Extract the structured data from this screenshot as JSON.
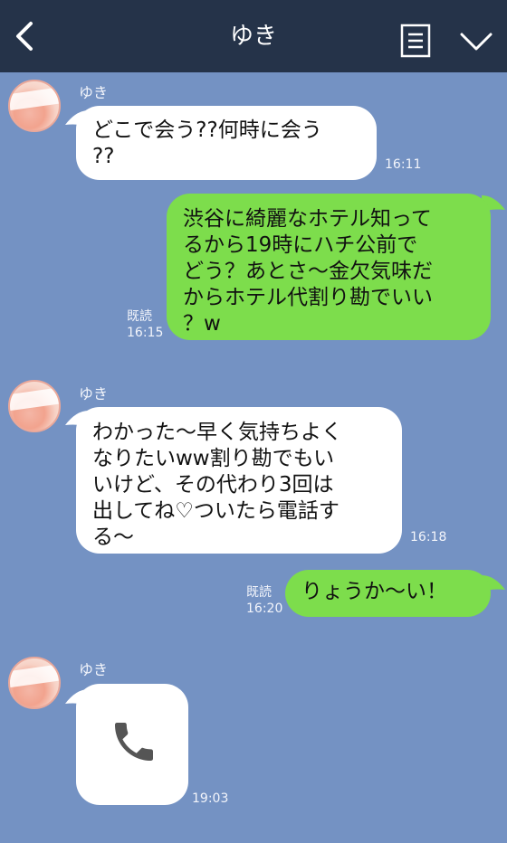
{
  "header": {
    "title": "ゆき"
  },
  "messages": [
    {
      "sender": "ゆき",
      "text": "どこで会う??何時に会う\n??",
      "time": "16:11"
    },
    {
      "text": "渋谷に綺麗なホテル知って\nるから19時にハチ公前で\nどう？あとさ〜金欠気味だ\nからホテル代割り勘でいい\n？w",
      "read": "既読",
      "time": "16:15"
    },
    {
      "sender": "ゆき",
      "text": "わかった〜早く気持ちよく\nなりたいww割り勘でもい\nいけど、その代わり3回は\n出してね♡ついたら電話す\nる〜",
      "time": "16:18"
    },
    {
      "text": "りょうか〜い！",
      "read": "既読",
      "time": "16:20"
    },
    {
      "sender": "ゆき",
      "type": "call",
      "icon": "phone-icon",
      "time": "19:03"
    }
  ],
  "colors": {
    "header_bg": "#253349",
    "chat_bg": "#7492c3",
    "my_bubble": "#7ddd4c",
    "their_bubble": "#ffffff"
  }
}
